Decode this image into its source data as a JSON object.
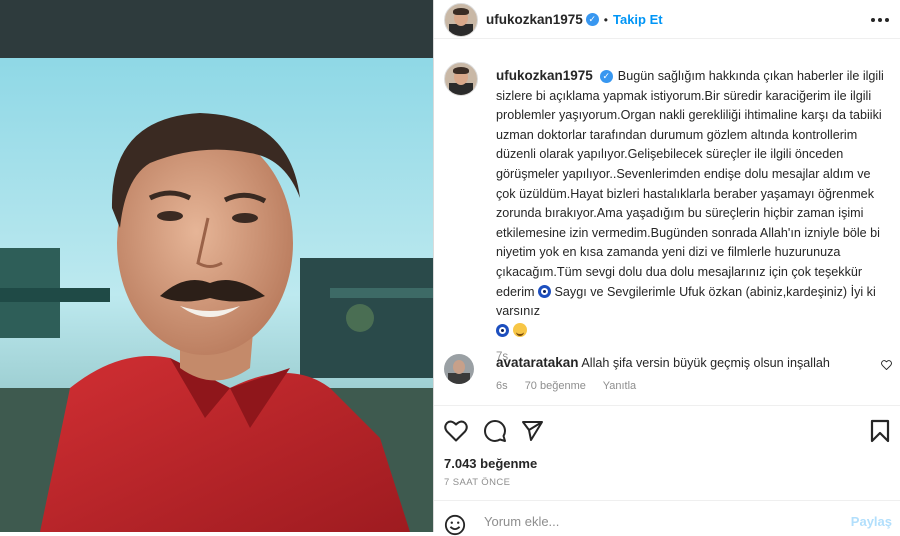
{
  "post": {
    "username": "ufukozkan1975",
    "verified_mark": "✓",
    "separator": "•",
    "follow_label": "Takip Et",
    "more_icon": "more-options-icon"
  },
  "caption": {
    "username": "ufukozkan1975",
    "text": "Bugün sağlığım hakkında çıkan haberler ile ilgili sizlere bi açıklama yapmak istiyorum.Bir süredir karaciğerim ile ilgili problemler yaşıyorum.Organ nakli gerekliliği ihtimaline karşı da tabiiki uzman doktorlar tarafından durumum gözlem altında kontrollerim düzenli olarak yapılıyor.Gelişebilecek süreçler ile ilgili önceden görüşmeler yapılıyor..Sevenlerimden endişe dolu mesajlar aldım ve çok üzüldüm.Hayat bizleri hastalıklarla beraber yaşamayı öğrenmek zorunda bırakıyor.Ama yaşadığım bu süreçlerin hiçbir zaman işimi etkilemesine izin vermedim.Bugünden sonrada Allah'ın izniyle böle bi niyetim yok en kısa zamanda yeni dizi ve filmlerle huzurunuza çıkacağım.Tüm sevgi dolu dua dolu mesajlarınız için çok teşekkür ederim",
    "text_2": "Saygı ve Sevgilerimle Ufuk özkan (abiniz,kardeşiniz) İyi ki varsınız",
    "age": "7s"
  },
  "comment": {
    "username": "avataratakan",
    "text": "Allah şifa versin büyük geçmiş olsun inşallah",
    "age": "6s",
    "likes": "70 beğenme",
    "reply_label": "Yanıtla"
  },
  "stats": {
    "likes": "7.043 beğenme",
    "time": "7 SAAT ÖNCE"
  },
  "comment_input": {
    "placeholder": "Yorum ekle...",
    "post_label": "Paylaş"
  },
  "colors": {
    "accent": "#0095f6",
    "verified": "#3897f0",
    "shirt": "#c9252b"
  }
}
